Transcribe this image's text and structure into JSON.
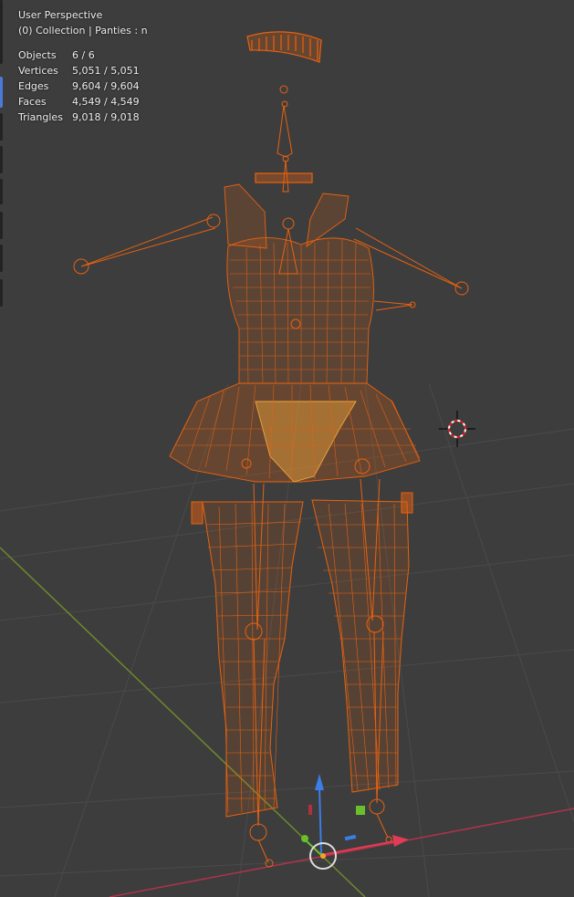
{
  "viewport": {
    "view_name": "User Perspective",
    "collection_line": "(0) Collection | Panties : n"
  },
  "stats": [
    {
      "label": "Objects",
      "value": "6 / 6"
    },
    {
      "label": "Vertices",
      "value": "5,051 / 5,051"
    },
    {
      "label": "Edges",
      "value": "9,604 / 9,604"
    },
    {
      "label": "Faces",
      "value": "4,549 / 4,549"
    },
    {
      "label": "Triangles",
      "value": "9,018 / 9,018"
    }
  ],
  "colors": {
    "background": "#3d3d3d",
    "grid": "#4a4a4a",
    "wire_selected": "#e8620f",
    "wire_active": "#f0a53a",
    "x_axis": "#b0334a",
    "y_axis": "#6b8a2c",
    "gizmo_z": "#3b7ee8",
    "gizmo_x": "#e23b55",
    "gizmo_y": "#6ac02a"
  },
  "icons": [
    "3d-cursor-icon",
    "transform-gizmo-icon"
  ]
}
